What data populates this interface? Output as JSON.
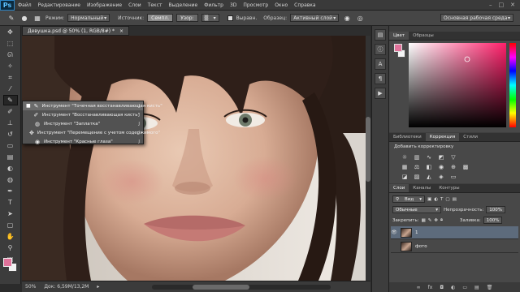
{
  "app": {
    "logo": "Ps",
    "menu": [
      "Файл",
      "Редактирование",
      "Изображение",
      "Слои",
      "Текст",
      "Выделение",
      "Фильтр",
      "3D",
      "Просмотр",
      "Окно",
      "Справка"
    ]
  },
  "options": {
    "mode_label": "Режим:",
    "mode_value": "Нормальный",
    "source_label": "Источник:",
    "source_btn1": "Семпл.",
    "source_btn2": "Узор:",
    "align_label": "Выравн.",
    "sample_label": "Образец:",
    "sample_value": "Активный слой",
    "workspace": "Основная рабочая среда"
  },
  "document": {
    "tab_title": "Девушка.psd @ 50% (1, RGB/8#) *",
    "close": "×"
  },
  "flyout": [
    {
      "label": "Инструмент \"Точечная восстанавливающая кисть\"",
      "key": "J",
      "selected": true,
      "icon": "spot-heal-icon"
    },
    {
      "label": "Инструмент \"Восстанавливающая кисть\"",
      "key": "J",
      "selected": false,
      "icon": "heal-brush-icon"
    },
    {
      "label": "Инструмент \"Заплатка\"",
      "key": "J",
      "selected": false,
      "icon": "patch-icon"
    },
    {
      "label": "Инструмент \"Перемещение с учетом содержимого\"",
      "key": "J",
      "selected": false,
      "icon": "content-move-icon"
    },
    {
      "label": "Инструмент \"Красные глаза\"",
      "key": "J",
      "selected": false,
      "icon": "red-eye-icon"
    }
  ],
  "status": {
    "zoom": "50%",
    "doc": "Док: 6,59M/13,2M"
  },
  "panels": {
    "color_tabs": [
      "Цвет",
      "Образцы"
    ],
    "correction_tabs": [
      "Библиотеки",
      "Коррекция",
      "Стили"
    ],
    "correction_title": "Добавить корректировку",
    "layers_tabs": [
      "Слои",
      "Каналы",
      "Контуры"
    ],
    "filter_label": "Вид",
    "blend_mode": "Обычные",
    "opacity_label": "Непрозрачность:",
    "opacity_value": "100%",
    "lock_label": "Закрепить:",
    "fill_label": "Заливка:",
    "fill_value": "100%",
    "layers": [
      {
        "name": "1",
        "visible": true,
        "active": true
      },
      {
        "name": "фото",
        "visible": false,
        "active": false
      }
    ]
  },
  "colors": {
    "foreground": "#e0729a",
    "background": "#f2f2f2",
    "accent": "#5cc1ff"
  }
}
